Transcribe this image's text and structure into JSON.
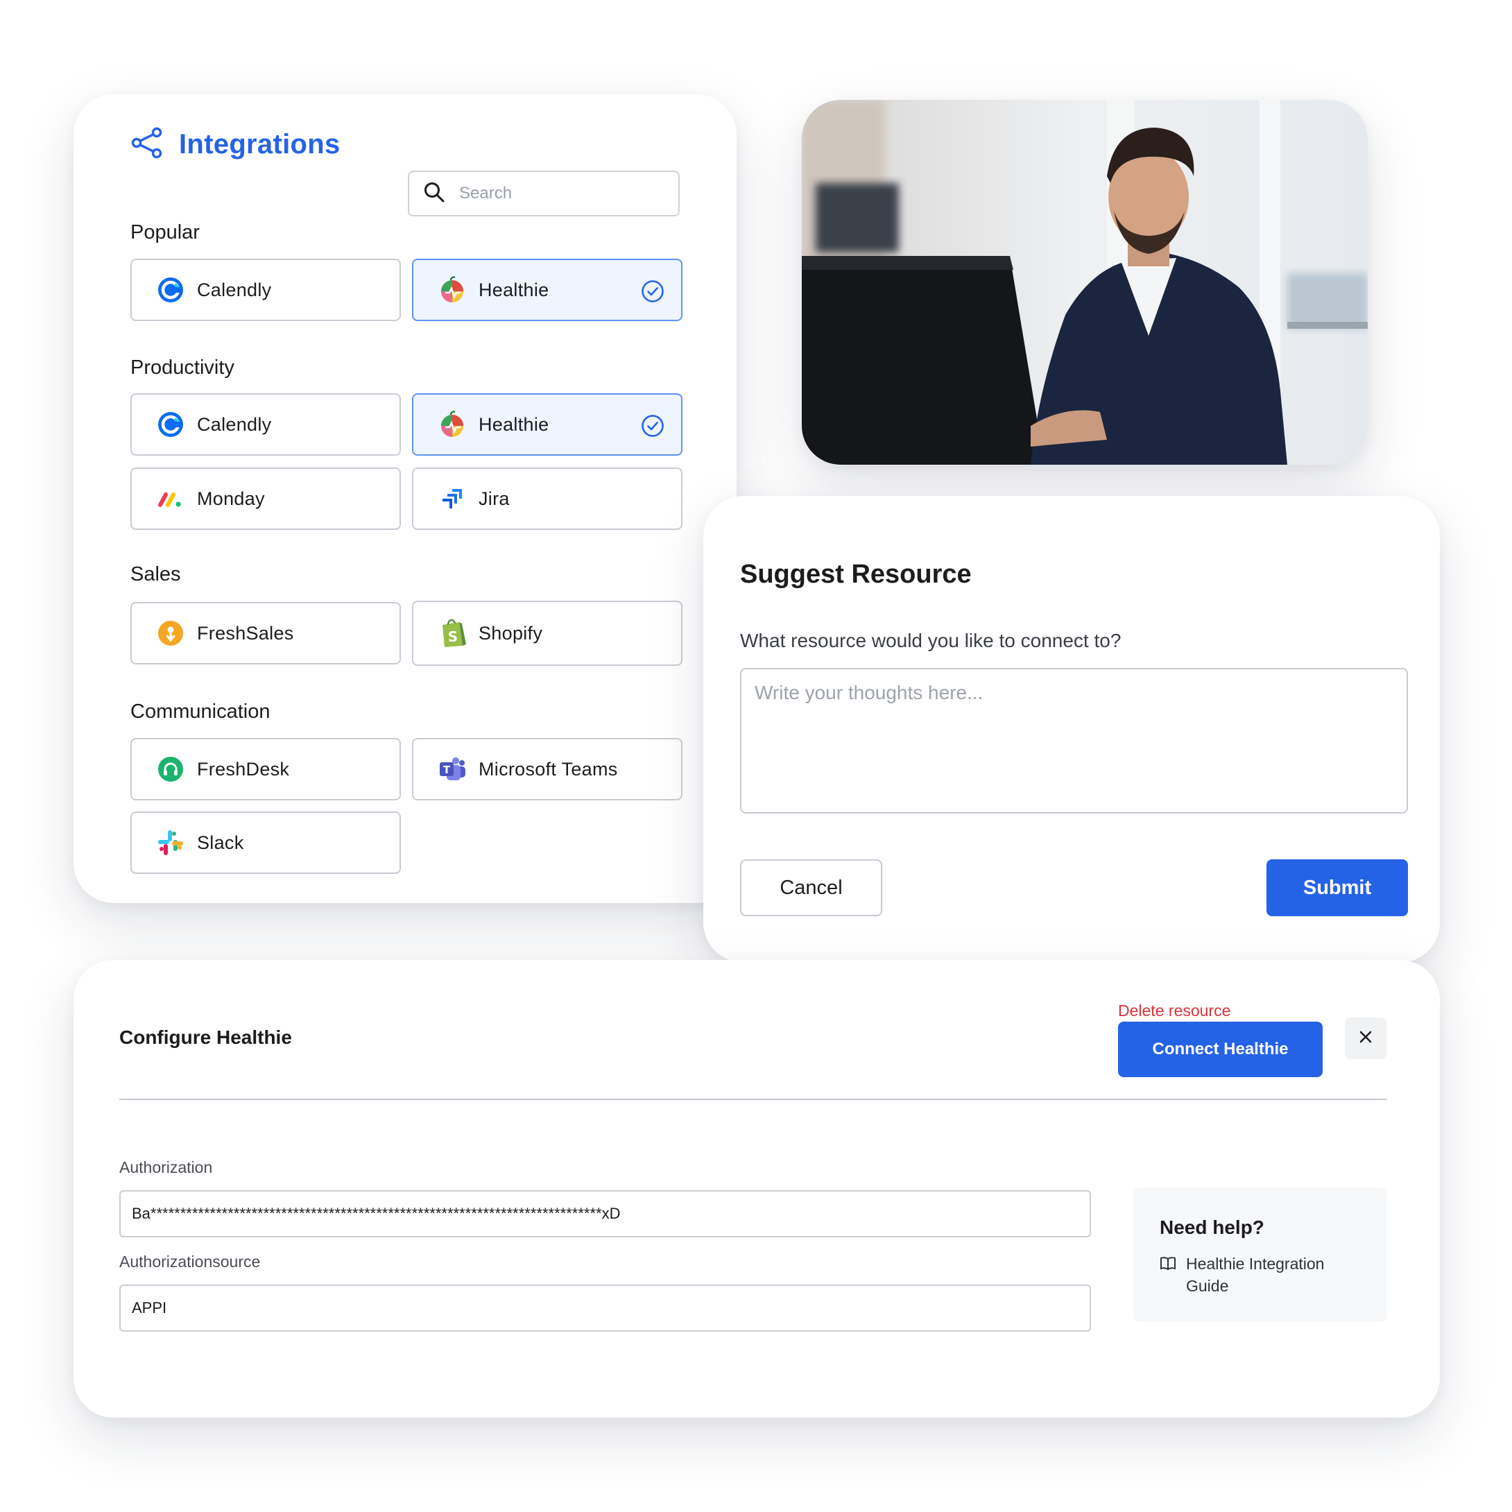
{
  "integrations": {
    "title": "Integrations",
    "search_placeholder": "Search",
    "sections": [
      {
        "label": "Popular",
        "items": [
          {
            "name": "Calendly",
            "selected": false,
            "icon": "calendly-logo"
          },
          {
            "name": "Healthie",
            "selected": true,
            "icon": "healthie-logo"
          }
        ]
      },
      {
        "label": "Productivity",
        "items": [
          {
            "name": "Calendly",
            "selected": false,
            "icon": "calendly-logo"
          },
          {
            "name": "Healthie",
            "selected": true,
            "icon": "healthie-logo"
          },
          {
            "name": "Monday",
            "selected": false,
            "icon": "monday-logo"
          },
          {
            "name": "Jira",
            "selected": false,
            "icon": "jira-logo"
          }
        ]
      },
      {
        "label": "Sales",
        "items": [
          {
            "name": "FreshSales",
            "selected": false,
            "icon": "freshsales-logo"
          },
          {
            "name": "Shopify",
            "selected": false,
            "icon": "shopify-logo"
          }
        ]
      },
      {
        "label": "Communication",
        "items": [
          {
            "name": "FreshDesk",
            "selected": false,
            "icon": "freshdesk-logo"
          },
          {
            "name": "Microsoft Teams",
            "selected": false,
            "icon": "teams-logo"
          },
          {
            "name": "Slack",
            "selected": false,
            "icon": "slack-logo"
          }
        ]
      }
    ]
  },
  "suggest": {
    "title": "Suggest Resource",
    "question": "What resource would you like to connect to?",
    "textarea_placeholder": "Write your thoughts here...",
    "cancel_label": "Cancel",
    "submit_label": "Submit"
  },
  "configure": {
    "title": "Configure Healthie",
    "delete_label": "Delete resource",
    "connect_label": "Connect Healthie",
    "fields": [
      {
        "label": "Authorization",
        "value": "Ba****************************************************************************xD"
      },
      {
        "label": "Authorizationsource",
        "value": "APPI"
      }
    ],
    "help": {
      "title": "Need help?",
      "link_label": "Healthie Integration Guide"
    }
  },
  "colors": {
    "accent": "#2563e6",
    "danger": "#d8343a",
    "selected_bg": "#eef5fe",
    "selected_border": "#5f93f3"
  }
}
